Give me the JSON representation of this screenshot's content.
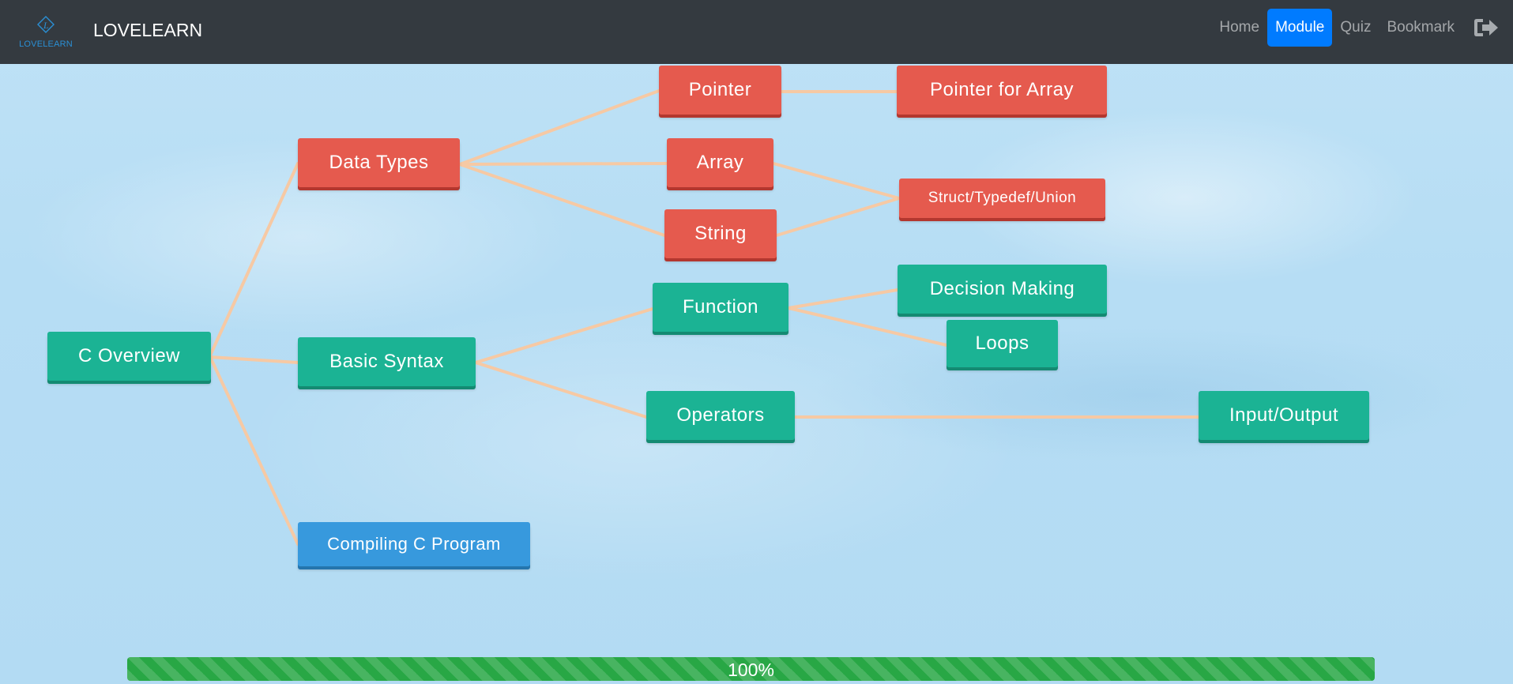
{
  "app": {
    "logo_text": "LOVELEARN",
    "brand_name": "LOVELEARN"
  },
  "nav": {
    "items": [
      {
        "label": "Home",
        "active": false
      },
      {
        "label": "Module",
        "active": true
      },
      {
        "label": "Quiz",
        "active": false
      },
      {
        "label": "Bookmark",
        "active": false
      }
    ],
    "logout_icon": "sign-out-icon"
  },
  "mindmap": {
    "nodes": {
      "c_overview": "C Overview",
      "data_types": "Data Types",
      "basic_syntax": "Basic Syntax",
      "compiling": "Compiling C Program",
      "pointer": "Pointer",
      "array": "Array",
      "string": "String",
      "pointer_for_array": "Pointer for Array",
      "struct": "Struct/Typedef/Union",
      "function": "Function",
      "operators": "Operators",
      "decision_making": "Decision Making",
      "loops": "Loops",
      "input_output": "Input/Output"
    },
    "colors": {
      "red": "#e55a4e",
      "green": "#1bb394",
      "blue": "#3799dd",
      "connector": "#f6c9a4"
    }
  },
  "progress": {
    "label": "100%",
    "value": 1.0
  }
}
